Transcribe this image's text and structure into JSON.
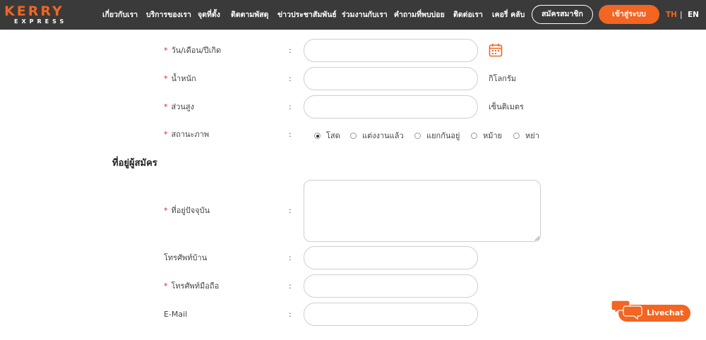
{
  "brand": {
    "name_top": "KERRY",
    "name_bottom": "EXPRESS",
    "accent": "#f26522",
    "nav_bg": "#3a3a3a"
  },
  "nav": {
    "items": [
      {
        "label": "เกี่ยวกับเรา"
      },
      {
        "label": "บริการของเรา"
      },
      {
        "label": "จุดที่ตั้ง"
      },
      {
        "label": "ติดตามพัสดุ"
      },
      {
        "label": "ข่าวประชาสัมพันธ์"
      },
      {
        "label": "ร่วมงานกับเรา"
      },
      {
        "label": "คำถามที่พบบ่อย"
      },
      {
        "label": "ติดต่อเรา"
      },
      {
        "label": "เคอรี่ คลับ"
      }
    ],
    "register_label": "สมัครสมาชิก",
    "login_label": "เข้าสู่ระบบ",
    "lang_th": "TH",
    "lang_separator": "|",
    "lang_en": "EN"
  },
  "form": {
    "required_mark": "*",
    "colon": ":",
    "birthdate": {
      "label": "วัน/เดือน/ปีเกิด",
      "value": "",
      "icon": "calendar-icon"
    },
    "weight": {
      "label": "น้ำหนัก",
      "value": "",
      "unit": "กิโลกรัม"
    },
    "height": {
      "label": "ส่วนสูง",
      "value": "",
      "unit": "เซ็นติเมตร"
    },
    "marital_status": {
      "label": "สถานะภาพ",
      "options": [
        "โสด",
        "แต่งงานแล้ว",
        "แยกกันอยู่",
        "หม้าย",
        "หย่า"
      ],
      "selected": "โสด"
    },
    "address_section_title": "ที่อยู่ผู้สมัคร",
    "current_address": {
      "label": "ที่อยู่ปัจจุบัน",
      "value": ""
    },
    "home_phone": {
      "label": "โทรศัพท์บ้าน",
      "value": ""
    },
    "mobile_phone": {
      "label": "โทรศัพท์มือถือ",
      "value": ""
    },
    "email": {
      "label": "E-Mail",
      "value": ""
    }
  },
  "livechat": {
    "label": "Livechat",
    "icon": "chat-bubbles-icon"
  }
}
